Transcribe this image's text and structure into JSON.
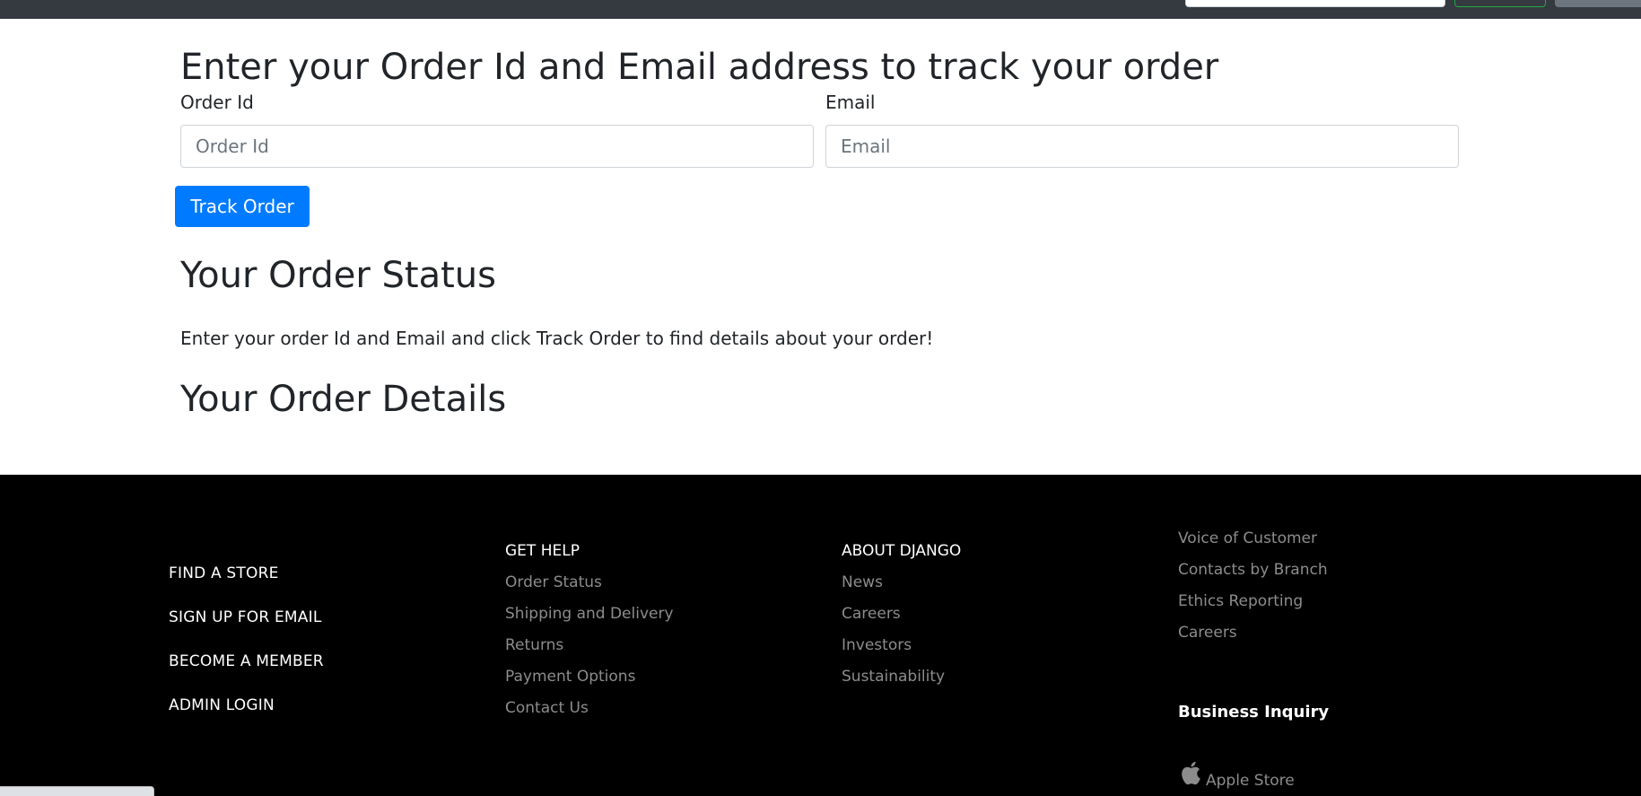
{
  "tracking": {
    "heading": "Enter your Order Id and Email address to track your order",
    "order_id_label": "Order Id",
    "order_id_placeholder": "Order Id",
    "email_label": "Email",
    "email_placeholder": "Email",
    "submit_label": "Track Order"
  },
  "status": {
    "heading": "Your Order Status",
    "message": "Enter your order Id and Email and click Track Order to find details about your order!"
  },
  "details": {
    "heading": "Your Order Details"
  },
  "footer": {
    "main_links": [
      "FIND A STORE",
      "SIGN UP FOR EMAIL",
      "BECOME A MEMBER",
      "ADMIN LOGIN"
    ],
    "help": {
      "title": "GET HELP",
      "links": [
        "Order Status",
        "Shipping and Delivery",
        "Returns",
        "Payment Options",
        "Contact Us"
      ]
    },
    "about": {
      "title": "ABOUT DJANGO",
      "links": [
        "News",
        "Careers",
        "Investors",
        "Sustainability"
      ]
    },
    "more": {
      "links": [
        "Voice of Customer",
        "Contacts by Branch",
        "Ethics Reporting",
        "Careers"
      ],
      "business": "Business Inquiry",
      "app_store": "Apple Store",
      "app_store_icon": "apple-icon"
    }
  },
  "colors": {
    "navbar": "#343a40",
    "primary": "#007bff",
    "footer_bg": "#000000",
    "footer_link": "#8c8c8c"
  }
}
